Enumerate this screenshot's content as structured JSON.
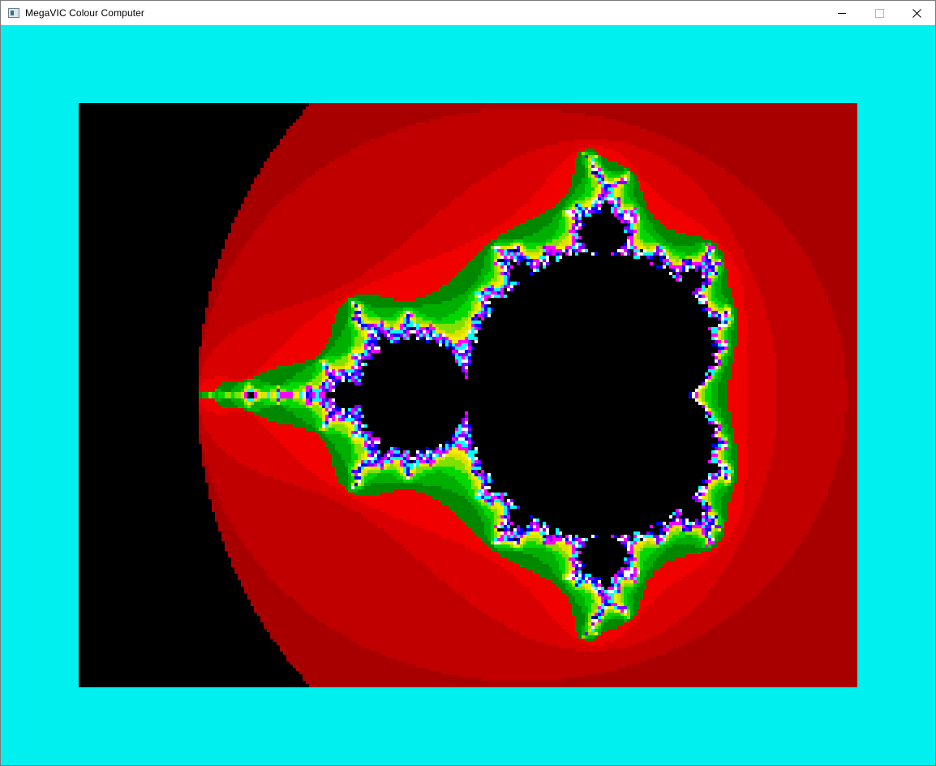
{
  "window": {
    "title": "MegaVIC Colour Computer",
    "icon": "app-window-icon",
    "controls": {
      "minimize_icon": "minimize-icon",
      "maximize_icon": "maximize-icon",
      "close_icon": "close-icon"
    }
  },
  "display": {
    "border_color": "#00f0f0",
    "background_color": "#000000",
    "content": "mandelbrot-fractal",
    "palette": [
      "#a80000",
      "#c00000",
      "#d80000",
      "#f00000",
      "#008800",
      "#00b000",
      "#00d800",
      "#80e000",
      "#e0e000",
      "#f0f000",
      "#0000ff",
      "#8000ff",
      "#ff00ff",
      "#00ffff",
      "#ffffff"
    ]
  }
}
